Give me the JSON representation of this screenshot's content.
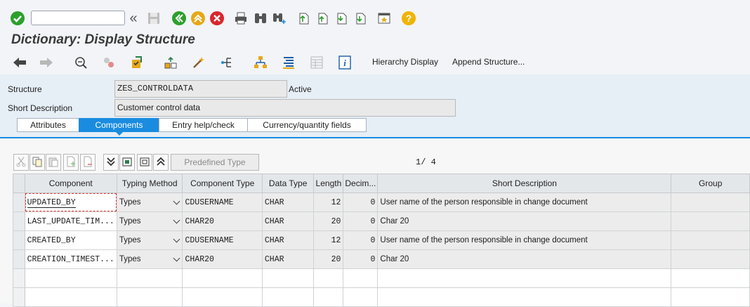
{
  "window": {
    "title": "Dictionary: Display Structure",
    "command_field_value": ""
  },
  "app_toolbar": {
    "hierarchy_display_label": "Hierarchy Display",
    "append_structure_label": "Append Structure..."
  },
  "header": {
    "structure_label": "Structure",
    "structure_value": "ZES_CONTROLDATA",
    "status": "Active",
    "short_description_label": "Short Description",
    "short_description_value": "Customer control data"
  },
  "tabs": [
    {
      "label": "Attributes",
      "active": false
    },
    {
      "label": "Components",
      "active": true
    },
    {
      "label": "Entry help/check",
      "active": false
    },
    {
      "label": "Currency/quantity fields",
      "active": false
    }
  ],
  "table_toolbar": {
    "predefined_type_label": "Predefined Type",
    "pager": "1/  4"
  },
  "grid": {
    "columns": [
      "Component",
      "Typing Method",
      "Component Type",
      "Data Type",
      "Length",
      "Decim...",
      "Short Description",
      "Group"
    ],
    "rows": [
      {
        "component": "UPDATED_BY",
        "typing": "Types",
        "ctype": "CDUSERNAME",
        "dtype": "CHAR",
        "length": "12",
        "decimals": "0",
        "desc": "User name of the person responsible in change document",
        "group": ""
      },
      {
        "component": "LAST_UPDATE_TIM...",
        "typing": "Types",
        "ctype": "CHAR20",
        "dtype": "CHAR",
        "length": "20",
        "decimals": "0",
        "desc": "Char 20",
        "group": ""
      },
      {
        "component": "CREATED_BY",
        "typing": "Types",
        "ctype": "CDUSERNAME",
        "dtype": "CHAR",
        "length": "12",
        "decimals": "0",
        "desc": "User name of the person responsible in change document",
        "group": ""
      },
      {
        "component": "CREATION_TIMEST...",
        "typing": "Types",
        "ctype": "CHAR20",
        "dtype": "CHAR",
        "length": "20",
        "decimals": "0",
        "desc": "Char 20",
        "group": ""
      }
    ]
  },
  "colors": {
    "accent": "#1a8ce0",
    "confirm_green": "#2ca02c",
    "exit_yellow": "#e6a817",
    "cancel_red": "#d9262b",
    "help_yellow": "#f0b400"
  },
  "icons": {
    "system_toolbar": [
      "check-icon",
      "history-icon",
      "save-icon",
      "back-icon",
      "exit-icon",
      "cancel-icon",
      "print-icon",
      "find-icon",
      "find-next-icon",
      "first-page-icon",
      "previous-page-icon",
      "next-page-icon",
      "last-page-icon",
      "create-session-icon",
      "help-icon"
    ],
    "application_toolbar": [
      "back-arrow-icon",
      "forward-arrow-icon",
      "display-change-icon",
      "other-object-icon",
      "check-object-icon",
      "activate-icon",
      "where-used-icon",
      "object-list-icon",
      "navigation-window-icon",
      "hierarchy-icon",
      "object-overview-icon",
      "layout-icon",
      "info-icon"
    ],
    "table_toolbar": [
      "cut-icon",
      "copy-icon",
      "paste-icon",
      "insert-row-icon",
      "delete-row-icon",
      "expand-icon",
      "select-all-icon",
      "deselect-all-icon",
      "collapse-icon"
    ]
  }
}
